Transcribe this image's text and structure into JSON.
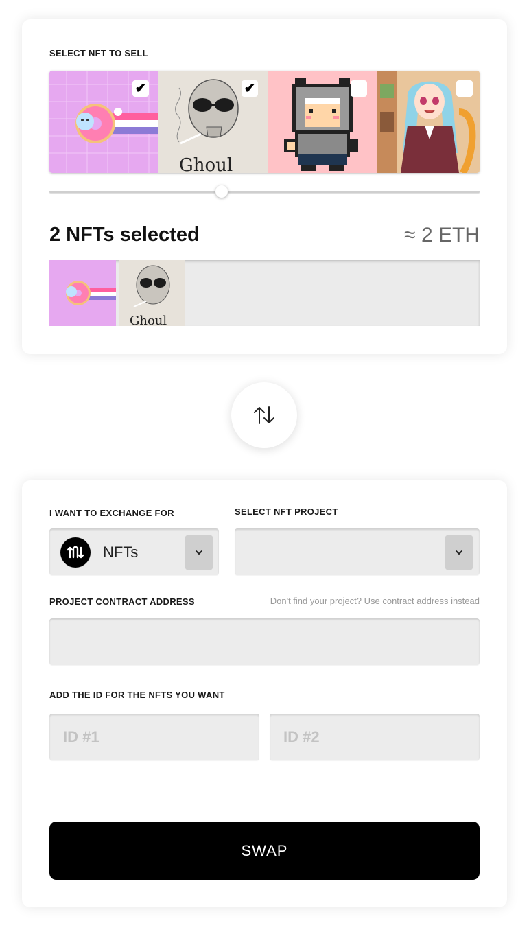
{
  "sell": {
    "label": "SELECT NFT TO SELL",
    "nfts": [
      {
        "name": "donut",
        "checked": true,
        "check_glyph": "✔"
      },
      {
        "name": "skull",
        "checked": true,
        "check_glyph": "✔"
      },
      {
        "name": "pixel-cat",
        "checked": false,
        "check_glyph": ""
      },
      {
        "name": "anime-girl",
        "checked": false,
        "check_glyph": ""
      }
    ],
    "slider_fraction": 0.4,
    "selected_title": "2 NFTs selected",
    "eth_total": "≈ 2 ETH"
  },
  "swap_icon": "swap-arrows-icon",
  "buy": {
    "exchange_label": "I WANT TO EXCHANGE FOR",
    "exchange_value": "NFTs",
    "project_label": "SELECT NFT PROJECT",
    "project_value": "",
    "contract_label": "PROJECT CONTRACT ADDRESS",
    "contract_hint": "Don't find your project? Use contract address instead",
    "contract_value": "",
    "ids_label": "ADD THE ID FOR THE NFTS YOU WANT",
    "id1_placeholder": "ID #1",
    "id2_placeholder": "ID #2",
    "swap_button": "SWAP"
  },
  "colors": {
    "button_bg": "#000000",
    "field_bg": "#ececec",
    "arrow_bg": "#cfcfcf"
  }
}
